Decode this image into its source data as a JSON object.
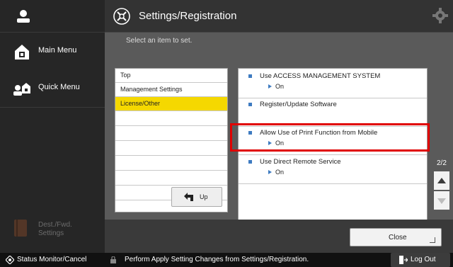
{
  "sidebar": {
    "main_menu": "Main Menu",
    "quick_menu": "Quick Menu",
    "dest_fwd_line1": "Dest./Fwd.",
    "dest_fwd_line2": "Settings"
  },
  "header": {
    "title": "Settings/Registration"
  },
  "content": {
    "instruction": "Select an item to set.",
    "tree": [
      {
        "label": "Top"
      },
      {
        "label": "Management Settings"
      },
      {
        "label": "License/Other",
        "selected": true
      }
    ],
    "up_label": "Up",
    "settings": [
      {
        "name": "Use ACCESS MANAGEMENT SYSTEM",
        "value": "On"
      },
      {
        "name": "Register/Update Software",
        "value": ""
      },
      {
        "name": "Allow Use of Print Function from Mobile",
        "value": "On"
      },
      {
        "name": "Use Direct Remote Service",
        "value": "On"
      }
    ],
    "page_indicator": "2/2",
    "close_label": "Close"
  },
  "status_bar": {
    "status_monitor": "Status Monitor/Cancel",
    "message": "Perform Apply Setting Changes from Settings/Registration.",
    "logout": "Log Out"
  },
  "colors": {
    "selected_item": "#f5d800",
    "highlight_box": "#e00000",
    "bullet": "#3e7bc1"
  }
}
